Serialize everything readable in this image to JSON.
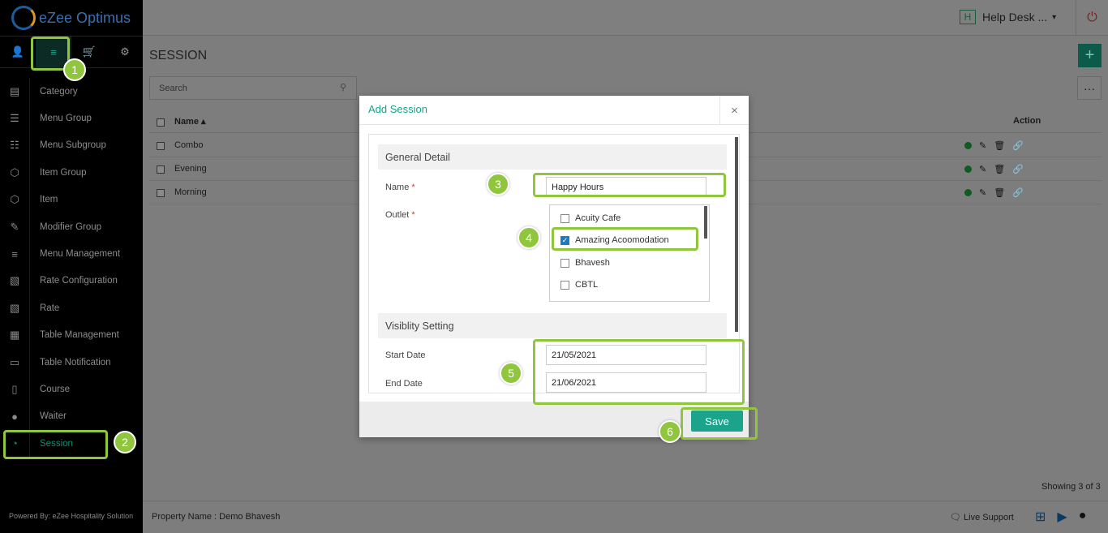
{
  "app": {
    "logo_text": "eZee Optimus",
    "power_icon": "power-icon"
  },
  "topbar": {
    "helpdesk_badge": "H",
    "helpdesk_label": "Help Desk ...",
    "caret": "▾"
  },
  "sidebar": {
    "tabs": [
      {
        "name": "user-icon",
        "glyph": "👤"
      },
      {
        "name": "menu-icon",
        "glyph": "≡"
      },
      {
        "name": "cart-icon",
        "glyph": "🛒"
      },
      {
        "name": "gear-icon",
        "glyph": "⚙"
      }
    ],
    "items": [
      {
        "label": "Category",
        "icon": "▤"
      },
      {
        "label": "Menu Group",
        "icon": "☰"
      },
      {
        "label": "Menu Subgroup",
        "icon": "☷"
      },
      {
        "label": "Item Group",
        "icon": "⬡"
      },
      {
        "label": "Item",
        "icon": "⬡"
      },
      {
        "label": "Modifier Group",
        "icon": "✎"
      },
      {
        "label": "Menu Management",
        "icon": "≡"
      },
      {
        "label": "Rate Configuration",
        "icon": "▧"
      },
      {
        "label": "Rate",
        "icon": "▧"
      },
      {
        "label": "Table Management",
        "icon": "▦"
      },
      {
        "label": "Table Notification",
        "icon": "▭"
      },
      {
        "label": "Course",
        "icon": "▯"
      },
      {
        "label": "Waiter",
        "icon": "●"
      },
      {
        "label": "Session",
        "icon": "◔"
      }
    ],
    "powered_by": "Powered By: eZee Hospitality Solution"
  },
  "page": {
    "title": "SESSION",
    "add_label": "+",
    "more_label": "···",
    "search_placeholder": "Search",
    "columns": {
      "name": "Name ▴",
      "action": "Action"
    },
    "rows": [
      {
        "name": "Combo"
      },
      {
        "name": "Evening"
      },
      {
        "name": "Morning"
      }
    ],
    "showing": "Showing 3 of 3"
  },
  "footer": {
    "property": "Property Name : Demo Bhavesh",
    "live_support": "Live Support"
  },
  "modal": {
    "title": "Add Session",
    "close": "×",
    "general_section": "General Detail",
    "name_label": "Name",
    "name_value": "Happy Hours",
    "outlet_label": "Outlet",
    "outlets": [
      {
        "label": "Acuity Cafe",
        "checked": false
      },
      {
        "label": "Amazing Acoomodation",
        "checked": true
      },
      {
        "label": "Bhavesh",
        "checked": false
      },
      {
        "label": "CBTL",
        "checked": false
      }
    ],
    "visibility_section": "Visiblity Setting",
    "start_label": "Start Date",
    "start_value": "21/05/2021",
    "end_label": "End Date",
    "end_value": "21/06/2021",
    "save_label": "Save"
  },
  "steps": [
    "1",
    "2",
    "3",
    "4",
    "5",
    "6"
  ],
  "colors": {
    "accent": "#1ba38b",
    "callout": "#8fc63e",
    "required": "#dd3333"
  }
}
